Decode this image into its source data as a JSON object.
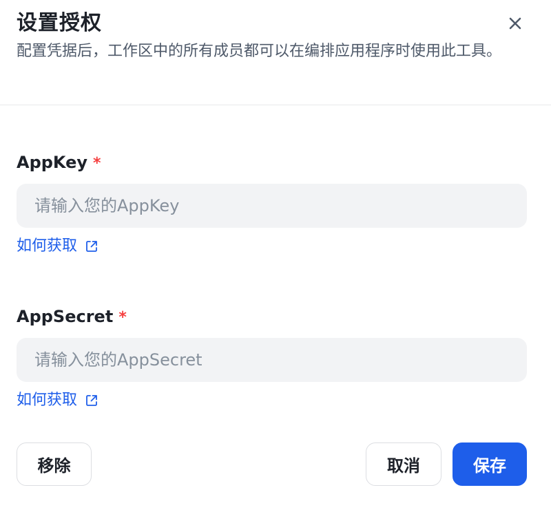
{
  "dialog": {
    "title": "设置授权",
    "subtitle": "配置凭据后，工作区中的所有成员都可以在编排应用程序时使用此工具。",
    "close_icon": "close-icon"
  },
  "fields": [
    {
      "label": "AppKey",
      "required_mark": "*",
      "value": "",
      "placeholder": "请输入您的AppKey",
      "help_link": "如何获取",
      "help_icon": "external-link-icon"
    },
    {
      "label": "AppSecret",
      "required_mark": "*",
      "value": "",
      "placeholder": "请输入您的AppSecret",
      "help_link": "如何获取",
      "help_icon": "external-link-icon"
    }
  ],
  "actions": {
    "remove_label": "移除",
    "cancel_label": "取消",
    "save_label": "保存"
  },
  "colors": {
    "primary": "#1e5eea",
    "required": "#f53f3f",
    "input_bg": "#f2f3f5",
    "link": "#1e5eea"
  }
}
